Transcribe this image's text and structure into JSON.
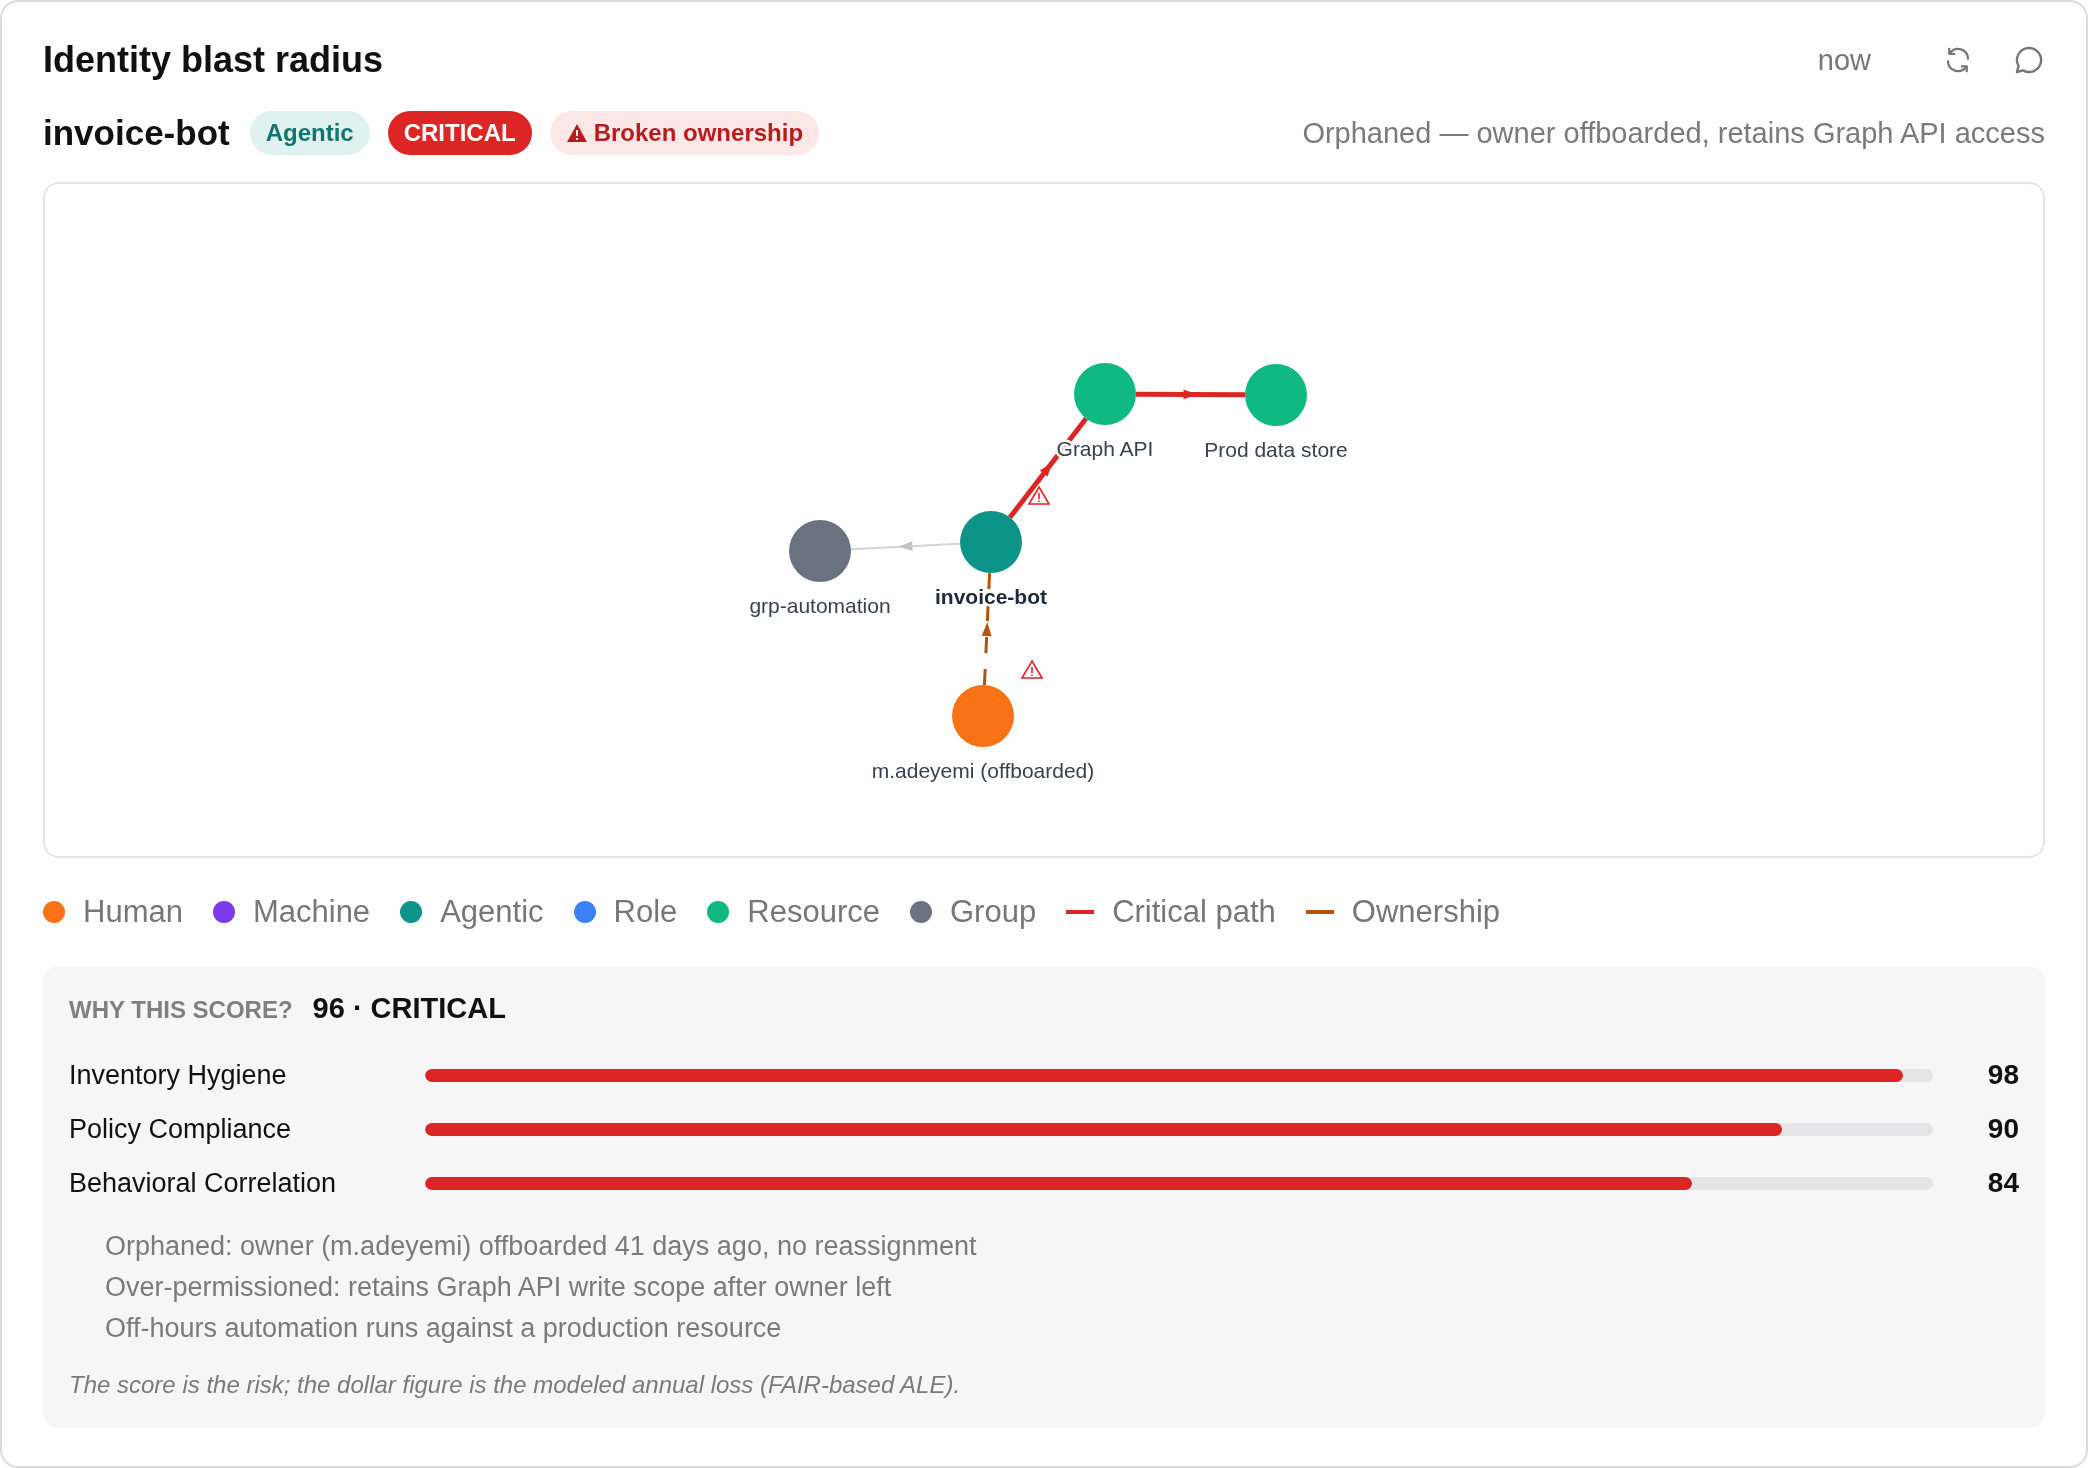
{
  "header": {
    "title": "Identity blast radius",
    "time": "now"
  },
  "entity": {
    "name": "invoice-bot",
    "badges": [
      {
        "label": "Agentic",
        "kind": "type"
      },
      {
        "label": "CRITICAL",
        "kind": "severity"
      },
      {
        "label": "Broken ownership",
        "kind": "alert"
      }
    ],
    "summary": "Orphaned — owner offboarded, retains Graph API access"
  },
  "graph": {
    "nodes": [
      {
        "label": "Graph API",
        "color": "#10b981",
        "focus": false
      },
      {
        "label": "Prod data store",
        "color": "#10b981",
        "focus": false
      },
      {
        "label": "grp-automation",
        "color": "#6b7280",
        "focus": false
      },
      {
        "label": "invoice-bot",
        "color": "#0d9488",
        "focus": true
      },
      {
        "label": "m.adeyemi (offboarded)",
        "color": "#f97316",
        "focus": false
      }
    ],
    "edges": [
      {
        "kind": "critical",
        "warning": true
      },
      {
        "kind": "critical"
      },
      {
        "kind": "membership"
      },
      {
        "kind": "ownership",
        "warning": true
      }
    ]
  },
  "legend": [
    {
      "label": "Human",
      "kind": "dot",
      "color": "#f97316"
    },
    {
      "label": "Machine",
      "kind": "dot",
      "color": "#7c3aed"
    },
    {
      "label": "Agentic",
      "kind": "dot",
      "color": "#0d9488"
    },
    {
      "label": "Role",
      "kind": "dot",
      "color": "#3b82f6"
    },
    {
      "label": "Resource",
      "kind": "dot",
      "color": "#10b981"
    },
    {
      "label": "Group",
      "kind": "dot",
      "color": "#6b7280"
    },
    {
      "label": "Critical path",
      "kind": "line",
      "color": "#dc2626"
    },
    {
      "label": "Ownership",
      "kind": "line",
      "color": "#b45309"
    }
  ],
  "score": {
    "heading": "WHY THIS SCORE?",
    "value": "96 · CRITICAL",
    "factors": [
      {
        "label": "Inventory Hygiene",
        "level": 0.98,
        "value": "98"
      },
      {
        "label": "Policy Compliance",
        "level": 0.9,
        "value": "90"
      },
      {
        "label": "Behavioral Correlation",
        "level": 0.84,
        "value": "84"
      }
    ],
    "reasons": [
      "Orphaned: owner (m.adeyemi) offboarded 41 days ago, no reassignment",
      "Over-permissioned: retains Graph API write scope after owner left",
      "Off-hours automation runs against a production resource"
    ],
    "note": "The score is the risk; the dollar figure is the modeled annual loss (FAIR-based ALE)."
  }
}
